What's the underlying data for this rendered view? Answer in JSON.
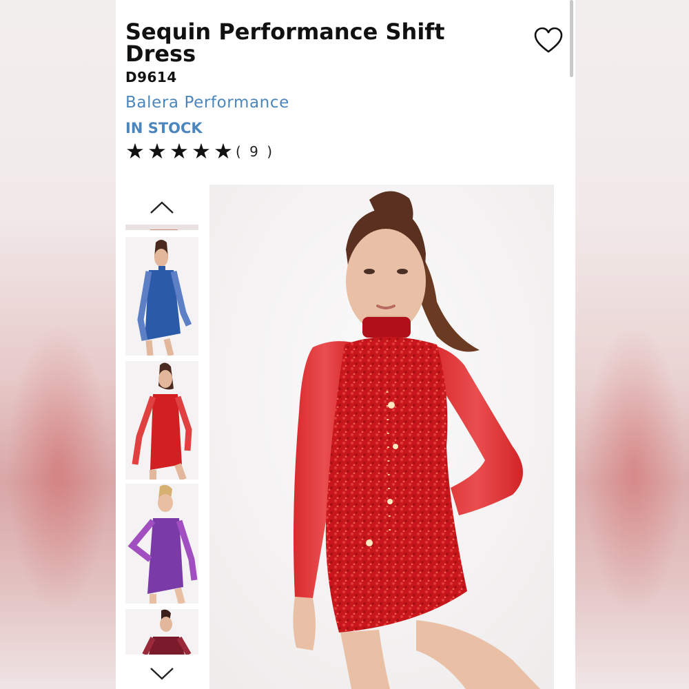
{
  "product": {
    "title": "Sequin Performance Shift Dress",
    "sku": "D9614",
    "brand": "Balera Performance",
    "stock_status": "IN STOCK",
    "rating_stars": 5,
    "review_count": "( 9 )"
  },
  "icons": {
    "favorite": "heart-outline-icon",
    "gallery_up": "chevron-up-icon",
    "gallery_down": "chevron-down-icon",
    "star": "star-filled-icon"
  },
  "gallery": {
    "thumbnails": [
      {
        "color_name": "",
        "dress_color": "#c4362c"
      },
      {
        "color_name": "",
        "dress_color": "#2a5aa8"
      },
      {
        "color_name": "",
        "dress_color": "#d21f22"
      },
      {
        "color_name": "",
        "dress_color": "#7a3aa8"
      },
      {
        "color_name": "",
        "dress_color": "#7a1a2a"
      }
    ],
    "selected_index": 2,
    "main_dress_color": "#d01f23"
  },
  "colors": {
    "brand_blue": "#4d86bc",
    "text": "#111111"
  }
}
